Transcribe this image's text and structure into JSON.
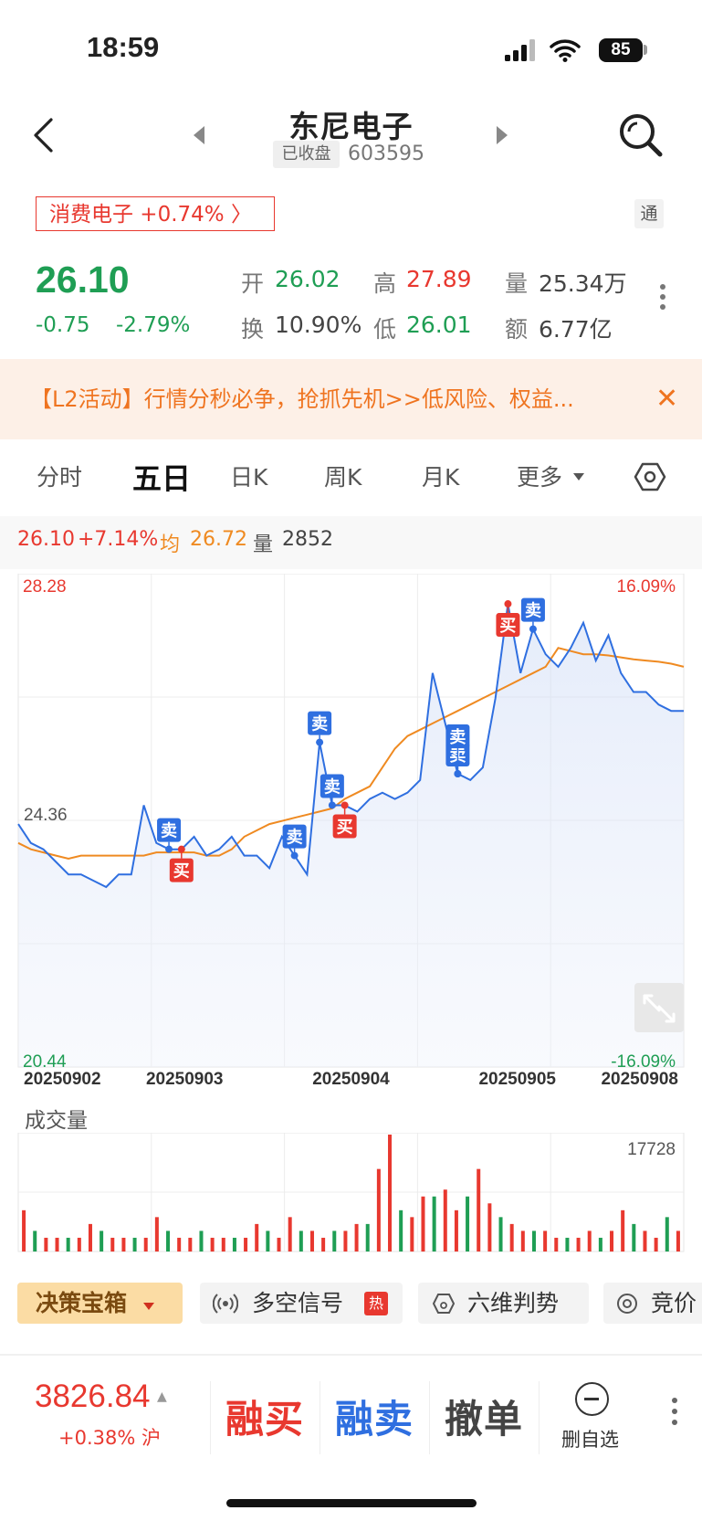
{
  "status_bar": {
    "time": "18:59",
    "battery": "85"
  },
  "header": {
    "title": "东尼电子",
    "status_tag": "已收盘",
    "code": "603595"
  },
  "sector": {
    "label": "消费电子 +0.74% 〉",
    "badge": "通"
  },
  "quote": {
    "price": "26.10",
    "change": "-0.75",
    "change_pct": "-2.79%",
    "open_label": "开",
    "open": "26.02",
    "high_label": "高",
    "high": "27.89",
    "volume_label": "量",
    "volume": "25.34万",
    "turnover_label": "换",
    "turnover": "10.90%",
    "low_label": "低",
    "low": "26.01",
    "amount_label": "额",
    "amount": "6.77亿"
  },
  "banner": {
    "text": "【L2活动】行情分秒必争，抢抓先机>>低风险、权益...",
    "close": "✕"
  },
  "tabs": [
    "分时",
    "五日",
    "日K",
    "周K",
    "月K",
    "更多"
  ],
  "info_bar": {
    "price": "26.10",
    "pct": "+7.14%",
    "avg_label": "均",
    "avg": "26.72",
    "vol_label": "量",
    "vol": "2852"
  },
  "chart_data": {
    "type": "line",
    "title": "",
    "x_labels": [
      "20250902",
      "20250903",
      "20250904",
      "20250905",
      "20250908"
    ],
    "y_max": "28.28",
    "y_mid": "24.36",
    "y_min": "20.44",
    "pct_max": "16.09%",
    "pct_min": "-16.09%",
    "ylim": [
      20.44,
      28.28
    ],
    "series": [
      {
        "values": [
          24.3,
          24.0,
          23.9,
          23.7,
          23.5,
          23.5,
          23.4,
          23.3,
          23.5,
          23.5,
          24.6,
          24.0,
          23.9,
          23.9,
          24.1,
          23.8,
          23.9,
          24.1,
          23.8,
          23.8,
          23.6,
          24.1,
          23.8,
          23.5,
          25.6,
          24.6,
          24.6,
          24.5,
          24.7,
          24.8,
          24.7,
          24.8,
          25.0,
          26.7,
          25.9,
          25.1,
          25.0,
          25.2,
          26.3,
          27.8,
          26.7,
          27.4,
          27.0,
          26.8,
          27.1,
          27.5,
          26.9,
          27.3,
          26.7,
          26.4,
          26.4,
          26.2,
          26.1,
          26.1
        ]
      },
      {
        "values": [
          24.0,
          23.9,
          23.85,
          23.8,
          23.75,
          23.8,
          23.8,
          23.8,
          23.8,
          23.8,
          23.8,
          23.85,
          23.85,
          23.85,
          23.85,
          23.8,
          23.8,
          23.9,
          24.1,
          24.2,
          24.3,
          24.35,
          24.4,
          24.45,
          24.5,
          24.55,
          24.7,
          24.8,
          24.9,
          25.2,
          25.5,
          25.7,
          25.8,
          25.9,
          26.0,
          26.1,
          26.2,
          26.3,
          26.4,
          26.5,
          26.6,
          26.7,
          26.8,
          27.1,
          27.05,
          27.0,
          27.0,
          26.98,
          26.95,
          26.92,
          26.9,
          26.88,
          26.85,
          26.8
        ]
      }
    ],
    "markers": [
      {
        "label": "卖",
        "type": "sell",
        "index": 12
      },
      {
        "label": "买",
        "type": "buy",
        "index": 13
      },
      {
        "label": "卖",
        "type": "sell",
        "index": 22
      },
      {
        "label": "卖",
        "type": "sell",
        "index": 24
      },
      {
        "label": "卖",
        "type": "sell",
        "index": 25
      },
      {
        "label": "买",
        "type": "buy",
        "index": 26
      },
      {
        "label": "卖",
        "type": "sell",
        "index": 35
      },
      {
        "label": "卖",
        "type": "sell",
        "index": 35
      },
      {
        "label": "买",
        "type": "buy",
        "index": 39
      },
      {
        "label": "卖",
        "type": "sell",
        "index": 41
      }
    ],
    "colors": {
      "price": "#2f6fe0",
      "avg": "#ef8a21",
      "up": "#e8382f",
      "down": "#1f9e54"
    }
  },
  "volume_chart": {
    "title": "成交量",
    "max_label": "17728",
    "values": [
      6,
      3,
      2,
      2,
      2,
      2,
      4,
      3,
      2,
      2,
      2,
      2,
      5,
      3,
      2,
      2,
      3,
      2,
      2,
      2,
      2,
      4,
      3,
      2,
      5,
      3,
      3,
      2,
      3,
      3,
      4,
      4,
      12,
      17,
      6,
      5,
      8,
      8,
      9,
      6,
      8,
      12,
      7,
      5,
      4,
      3,
      3,
      3,
      2,
      2,
      2,
      3,
      2,
      3,
      6,
      4,
      3,
      2,
      5,
      3
    ]
  },
  "tools": {
    "decision": "决策宝箱",
    "signal": "多空信号",
    "signal_badge": "热",
    "six": "六维判势",
    "bid": "竞价"
  },
  "bottom": {
    "index_value": "3826.84",
    "index_arrow": "▲",
    "index_sub": "+0.38% 沪",
    "margin_buy": "融买",
    "margin_sell": "融卖",
    "cancel": "撤单",
    "remove_watch": "删自选"
  }
}
